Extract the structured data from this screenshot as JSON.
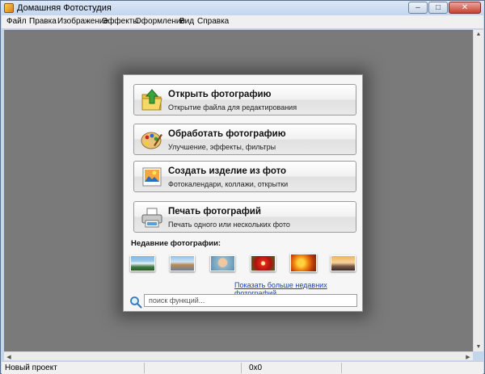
{
  "window": {
    "title": "Домашняя Фотостудия"
  },
  "menu": [
    "Файл",
    "Правка",
    "Изображение",
    "Эффекты",
    "Оформление",
    "Вид",
    "Справка"
  ],
  "actions": [
    {
      "title": "Открыть фотографию",
      "subtitle": "Открытие файла для редактирования",
      "icon": "folder-open-icon"
    },
    {
      "title": "Обработать фотографию",
      "subtitle": "Улучшение, эффекты, фильтры",
      "icon": "palette-icon"
    },
    {
      "title": "Создать изделие из фото",
      "subtitle": "Фотокалендари, коллажи, открытки",
      "icon": "picture-icon"
    },
    {
      "title": "Печать фотографий",
      "subtitle": "Печать одного или нескольких фото",
      "icon": "printer-icon"
    }
  ],
  "recent": {
    "label": "Недавние фотографии:",
    "thumbnails": [
      "waterfall",
      "city",
      "portrait",
      "red-flower",
      "autumn-leaves",
      "sunset-city"
    ],
    "more_link": "Показать больше недавних фотографий"
  },
  "search": {
    "placeholder": "поиск функций..."
  },
  "status": {
    "left": "Новый проект",
    "middle": "0x0"
  },
  "colors": {
    "workspace": "#7a7a7a",
    "link": "#1a3ec8",
    "panel": "#f6f6f6"
  }
}
